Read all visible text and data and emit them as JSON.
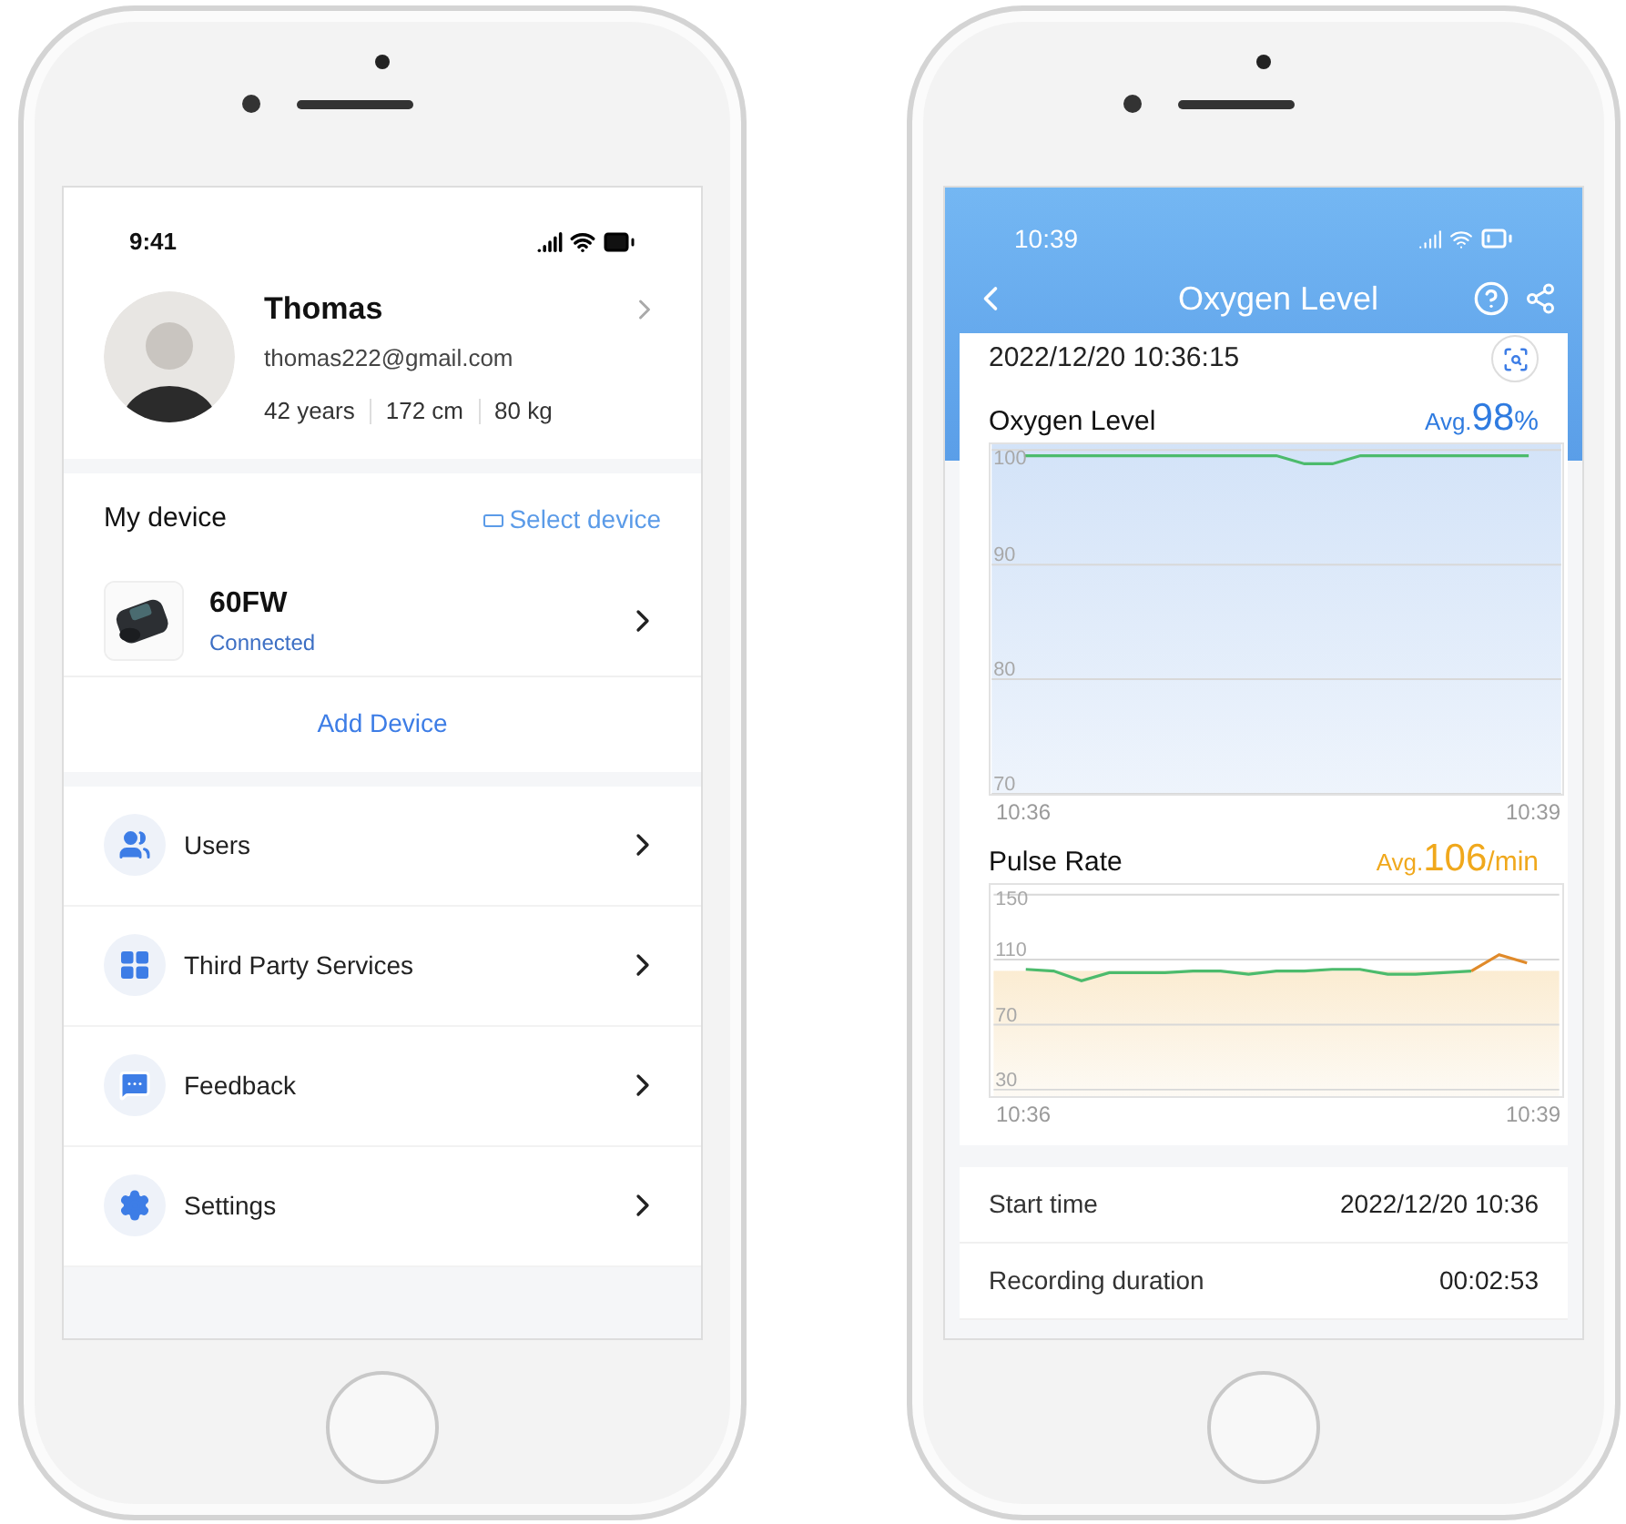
{
  "profile_screen": {
    "status_time": "9:41",
    "profile": {
      "name": "Thomas",
      "email": "thomas222@gmail.com",
      "stats": [
        "42 years",
        "172 cm",
        "80 kg"
      ]
    },
    "device_section": {
      "title": "My device",
      "action": "Select device"
    },
    "device": {
      "name": "60FW",
      "status": "Connected"
    },
    "add_device": "Add Device",
    "menu": [
      {
        "label": "Users",
        "kind": "users"
      },
      {
        "label": "Third Party Services",
        "kind": "services"
      },
      {
        "label": "Feedback",
        "kind": "feedback"
      },
      {
        "label": "Settings",
        "kind": "settings"
      }
    ]
  },
  "measurement_screen": {
    "status_time": "10:39",
    "title": "Oxygen Level",
    "timestamp": "2022/12/20 10:36:15",
    "charts": [
      {
        "label": "Oxygen Level",
        "avg_prefix": "Avg.",
        "avg_value": "98",
        "avg_unit": "%",
        "color": "#2f7be0",
        "chart_data": {
          "type": "line",
          "grid": true,
          "categories": [
            "10:36",
            null,
            null,
            null,
            null,
            null,
            null,
            null,
            null,
            null,
            null,
            null,
            null,
            null,
            null,
            null,
            null,
            null,
            "10:39"
          ],
          "ylim": [
            70,
            100.5
          ],
          "yticks": [
            70,
            80,
            90,
            100
          ],
          "series": [
            {
              "color": "#4cbb6c",
              "values": [
                99.5,
                99.5,
                99.5,
                99.5,
                99.5,
                99.5,
                99.5,
                99.5,
                99.5,
                99.5,
                98.8,
                98.8,
                99.5,
                99.5,
                99.5,
                99.5,
                99.5,
                99.5,
                99.5
              ]
            }
          ]
        }
      },
      {
        "label": "Pulse Rate",
        "avg_prefix": "Avg.",
        "avg_value": "106",
        "avg_unit": "/min",
        "color": "#f0a81c",
        "chart_data": {
          "type": "line",
          "grid": true,
          "categories": [
            "10:36",
            null,
            null,
            null,
            null,
            null,
            null,
            null,
            null,
            null,
            null,
            null,
            null,
            null,
            null,
            null,
            null,
            null,
            "10:39"
          ],
          "ylim": [
            26,
            156
          ],
          "yticks": [
            30,
            70,
            110,
            150
          ],
          "series": [
            {
              "color": "#4cbb6c",
              "values": [
                104,
                103,
                97,
                102,
                102,
                102,
                103,
                103,
                101,
                103,
                103,
                104,
                104,
                101,
                101,
                102,
                103,
                null,
                null
              ]
            },
            {
              "color": "#e08a2a",
              "values": [
                null,
                null,
                null,
                null,
                null,
                null,
                null,
                null,
                null,
                null,
                null,
                null,
                null,
                null,
                null,
                null,
                103,
                113,
                108
              ]
            }
          ]
        }
      }
    ],
    "details": [
      {
        "label": "Start time",
        "value": "2022/12/20 10:36"
      },
      {
        "label": "Recording duration",
        "value": "00:02:53"
      }
    ]
  }
}
